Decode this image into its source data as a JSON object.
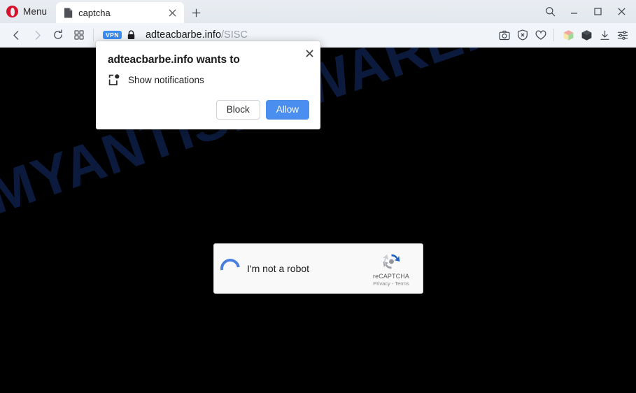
{
  "browser": {
    "menu_label": "Menu",
    "opera_logo_icon": "opera-logo-icon",
    "tabs": [
      {
        "title": "captcha",
        "favicon": "page-document-icon",
        "close_icon": "close-icon",
        "active": true
      }
    ],
    "new_tab_icon": "plus-icon",
    "window_controls": [
      {
        "name": "search-icon",
        "label": "Search"
      },
      {
        "name": "minimize-icon",
        "label": "Minimize"
      },
      {
        "name": "maximize-icon",
        "label": "Maximize"
      },
      {
        "name": "close-window-icon",
        "label": "Close"
      }
    ],
    "nav": {
      "back_icon": "chevron-left-icon",
      "forward_icon": "chevron-right-icon",
      "reload_icon": "reload-icon",
      "speeddial_icon": "grid-squares-icon"
    },
    "omnibox": {
      "vpn_badge": "VPN",
      "lock_icon": "lock-icon",
      "url_host": "adteacbarbe.info",
      "url_path": "/SISC"
    },
    "toolbar_icons": [
      {
        "name": "camera-snapshot-icon"
      },
      {
        "name": "adblock-shield-icon"
      },
      {
        "name": "heart-icon"
      },
      {
        "name": "rubik-cube-icon"
      },
      {
        "name": "crypto-wallet-cube-icon"
      },
      {
        "name": "download-icon"
      },
      {
        "name": "easy-setup-sliders-icon"
      }
    ]
  },
  "page": {
    "background_color": "#000000",
    "watermark_text": "MYANTISPYWARE.COM",
    "watermark_color": "#0c1b3d",
    "recaptcha": {
      "checkbox_state": "loading-spinner",
      "label": "I'm not a robot",
      "brand": "reCAPTCHA",
      "legal": "Privacy - Terms",
      "logo_icon": "recaptcha-logo-icon",
      "accent_color": "#4a7fe0"
    }
  },
  "notification_dialog": {
    "title": "adteacbarbe.info wants to",
    "permission_icon": "notification-permission-icon",
    "permission_label": "Show notifications",
    "close_icon": "close-icon",
    "block_label": "Block",
    "allow_label": "Allow",
    "allow_color": "#4a8ef0"
  }
}
